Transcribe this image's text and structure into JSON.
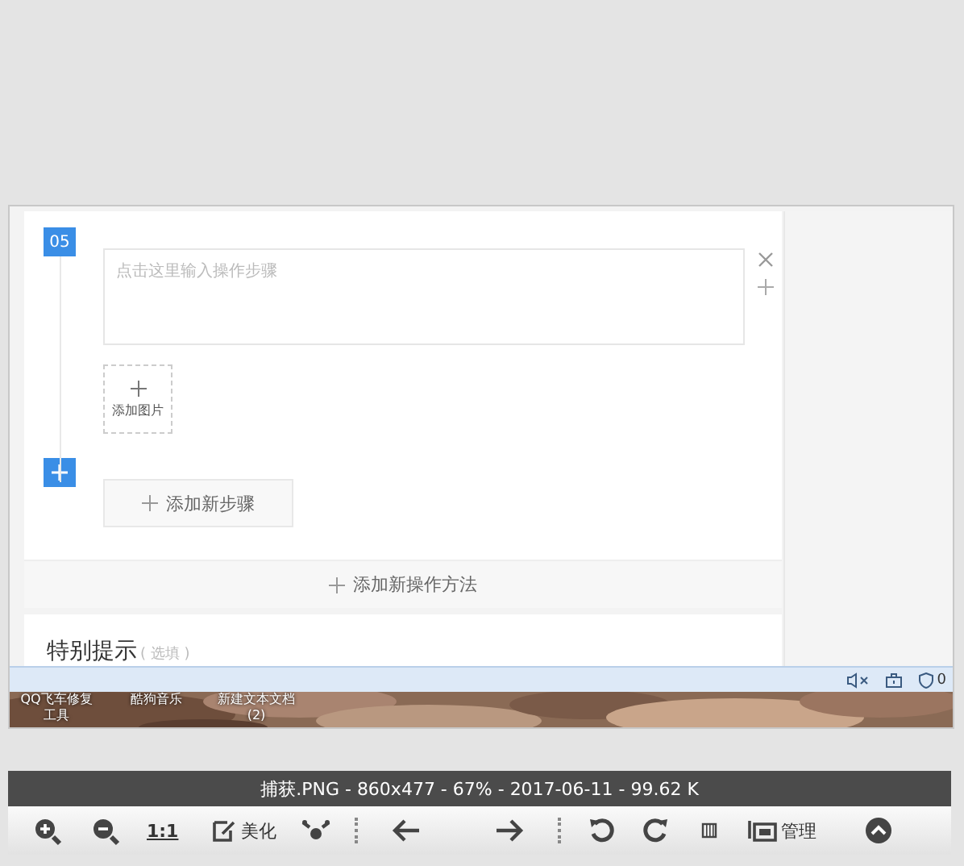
{
  "editor": {
    "step": {
      "number": "05",
      "placeholder": "点击这里输入操作步骤",
      "add_image": "添加图片"
    },
    "add_step": "添加新步骤",
    "add_method": "添加新操作方法",
    "tips": {
      "title": "特别提示",
      "hint": "( 选填 )"
    }
  },
  "browser_status": {
    "shield_count": "0"
  },
  "desktop": {
    "icons": [
      {
        "label": "QQ飞车修复工具"
      },
      {
        "label": "酷狗音乐"
      },
      {
        "label": "新建文本文档 (2)"
      }
    ]
  },
  "viewer": {
    "info": "捕获.PNG - 860x477 - 67% - 2017-06-11 - 99.62 K",
    "toolbar": {
      "actual_size": "1:1",
      "beautify": "美化",
      "manage": "管理"
    }
  }
}
